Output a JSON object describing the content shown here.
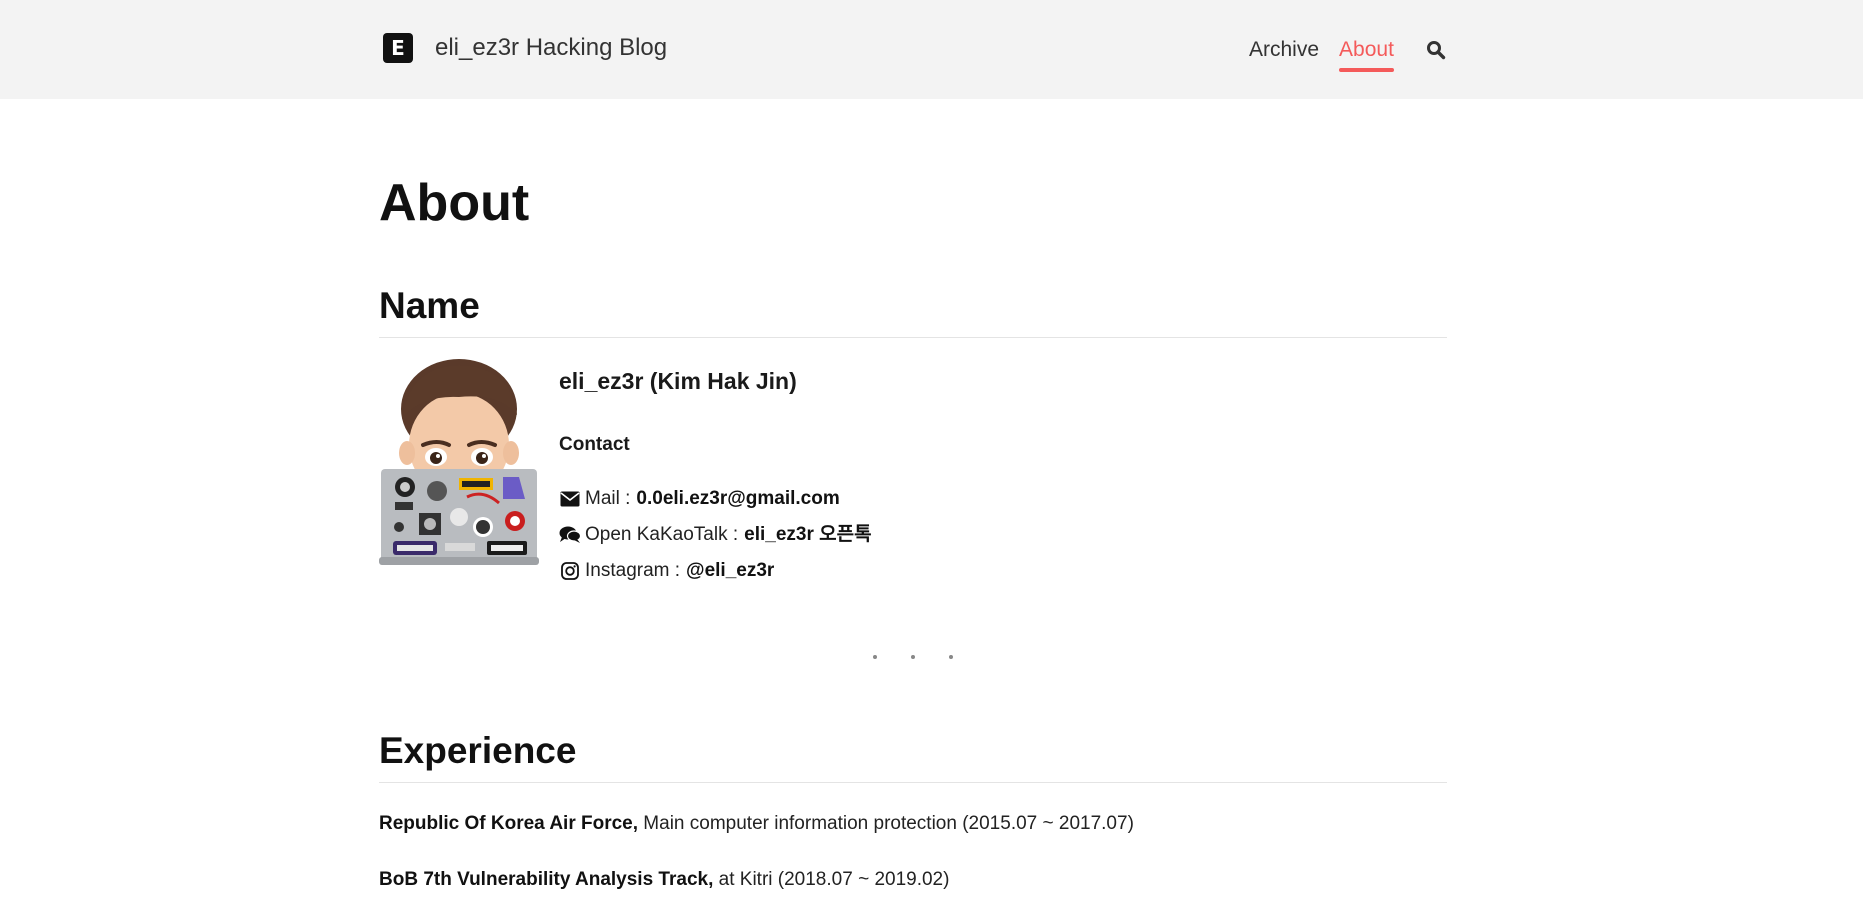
{
  "header": {
    "logo_letter": "E",
    "title": "eli_ez3r Hacking Blog",
    "nav": [
      {
        "label": "Archive",
        "active": false
      },
      {
        "label": "About",
        "active": true
      }
    ],
    "accent_color": "#f45a5a"
  },
  "page": {
    "title": "About"
  },
  "name_section": {
    "heading": "Name",
    "full_name": "eli_ez3r (Kim Hak Jin)",
    "contact_heading": "Contact",
    "contacts": [
      {
        "icon": "envelope-icon",
        "label": "Mail :",
        "value": "0.0eli.ez3r@gmail.com"
      },
      {
        "icon": "chat-bubbles-icon",
        "label": "Open KaKaoTalk :",
        "value": "eli_ez3r 오픈톡"
      },
      {
        "icon": "instagram-icon",
        "label": "Instagram :",
        "value": "@eli_ez3r"
      }
    ]
  },
  "experience_section": {
    "heading": "Experience",
    "items": [
      {
        "org": "Republic Of Korea Air Force,",
        "detail": "Main computer information protection (2015.07 ~ 2017.07)"
      },
      {
        "org": "BoB 7th Vulnerability Analysis Track,",
        "detail": "at Kitri (2018.07 ~ 2019.02)"
      }
    ]
  }
}
